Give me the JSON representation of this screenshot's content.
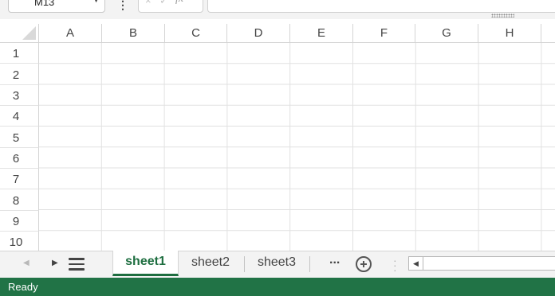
{
  "formula_bar": {
    "name_box": "M13",
    "formula_value": "",
    "fx_label": "fx",
    "cancel_icon": "×",
    "enter_icon": "✓"
  },
  "grid": {
    "columns": [
      "A",
      "B",
      "C",
      "D",
      "E",
      "F",
      "G",
      "H"
    ],
    "rows": [
      "1",
      "2",
      "3",
      "4",
      "5",
      "6",
      "7",
      "8",
      "9",
      "10"
    ]
  },
  "sheet_tabs": {
    "tabs": [
      "sheet1",
      "sheet2",
      "sheet3"
    ],
    "active_tab": "sheet1",
    "more_label": "..."
  },
  "status_bar": {
    "status": "Ready",
    "accent_color": "#217346"
  }
}
